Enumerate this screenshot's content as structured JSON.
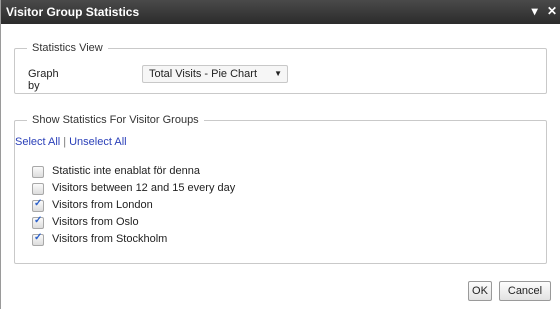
{
  "dialog": {
    "title": "Visitor Group Statistics",
    "controls": [
      "▾",
      "✕"
    ]
  },
  "statistics_view": {
    "legend": "Statistics View",
    "graph_label": "Graph by",
    "graph_value": "Total Visits - Pie Chart",
    "graph_arrow_icon": "chevron-down-icon"
  },
  "visitor_groups": {
    "legend": "Show Statistics For Visitor Groups",
    "select_all": "Select All",
    "separator": "|",
    "unselect_all": "Unselect All",
    "items": [
      {
        "label": "Statistic inte enablat för denna",
        "checked": false
      },
      {
        "label": "Visitors between 12 and 15 every day",
        "checked": false
      },
      {
        "label": "Visitors from London",
        "checked": true
      },
      {
        "label": "Visitors from Oslo",
        "checked": true
      },
      {
        "label": "Visitors from Stockholm",
        "checked": true
      }
    ]
  },
  "buttons": {
    "ok": "OK",
    "cancel": "Cancel"
  },
  "colors": {
    "titlebar": "#2b2b2b",
    "link": "#2a3fb8",
    "checkmark": "#2a5fc9"
  }
}
